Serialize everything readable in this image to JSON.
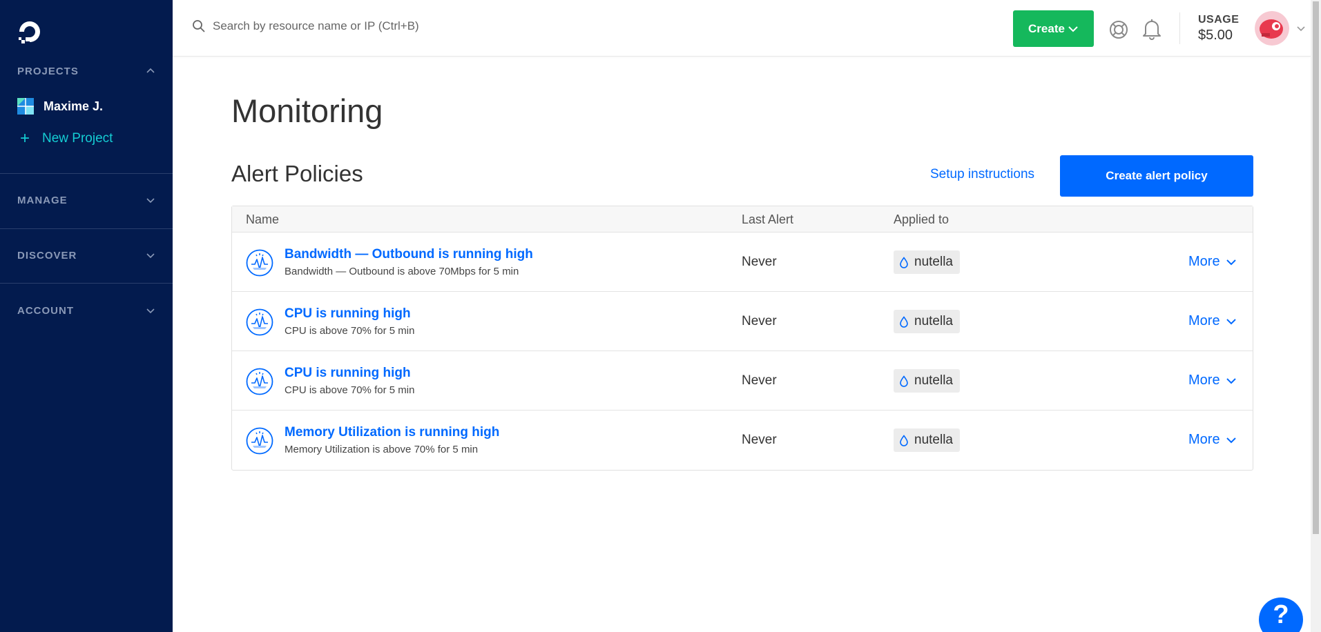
{
  "sidebar": {
    "projects_title": "PROJECTS",
    "project_name": "Maxime J.",
    "new_project_label": "New Project",
    "manage_title": "MANAGE",
    "discover_title": "DISCOVER",
    "account_title": "ACCOUNT"
  },
  "topbar": {
    "search_placeholder": "Search by resource name or IP (Ctrl+B)",
    "create_label": "Create",
    "usage_label": "USAGE",
    "usage_value": "$5.00"
  },
  "main": {
    "page_title": "Monitoring",
    "section_title": "Alert Policies",
    "setup_link": "Setup instructions",
    "create_alert_button": "Create alert policy",
    "table": {
      "headers": {
        "name": "Name",
        "last_alert": "Last Alert",
        "applied_to": "Applied to"
      },
      "rows": [
        {
          "title": "Bandwidth — Outbound is running high",
          "desc": "Bandwidth — Outbound is above 70Mbps for 5 min",
          "last_alert": "Never",
          "applied_to": "nutella",
          "more": "More"
        },
        {
          "title": "CPU is running high",
          "desc": "CPU is above 70% for 5 min",
          "last_alert": "Never",
          "applied_to": "nutella",
          "more": "More"
        },
        {
          "title": "CPU is running high",
          "desc": "CPU is above 70% for 5 min",
          "last_alert": "Never",
          "applied_to": "nutella",
          "more": "More"
        },
        {
          "title": "Memory Utilization is running high",
          "desc": "Memory Utilization is above 70% for 5 min",
          "last_alert": "Never",
          "applied_to": "nutella",
          "more": "More"
        }
      ]
    },
    "help_fab": "?"
  },
  "colors": {
    "sidebar_bg": "#031b4e",
    "brand_blue": "#0069ff",
    "create_green": "#15b85c",
    "new_project_cyan": "#15cdd3"
  },
  "icons": [
    "logo-icon",
    "chevron-up-icon",
    "chevron-down-icon",
    "search-icon",
    "help-lifebuoy-icon",
    "bell-icon",
    "monitor-alert-icon",
    "droplet-icon",
    "help-question-icon"
  ]
}
